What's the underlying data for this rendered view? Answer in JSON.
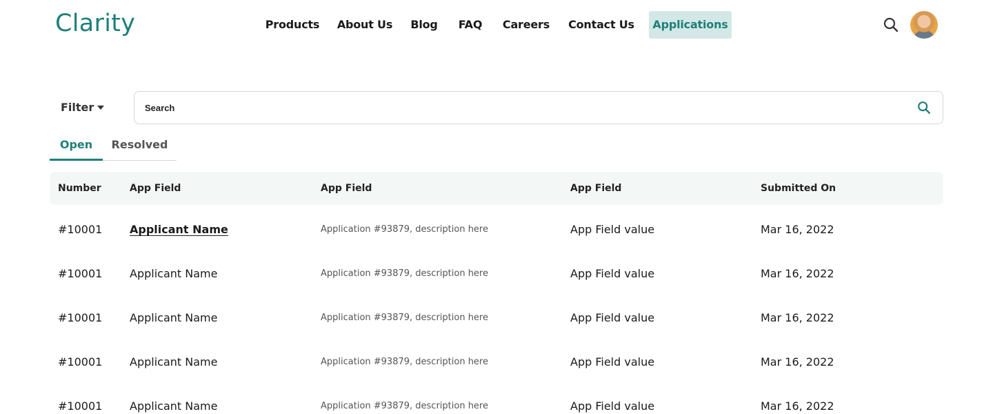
{
  "app": {
    "logo": "Clarity"
  },
  "nav": {
    "items": [
      {
        "label": "Products"
      },
      {
        "label": "About Us"
      },
      {
        "label": "Blog"
      },
      {
        "label": "FAQ"
      },
      {
        "label": "Careers"
      },
      {
        "label": "Contact Us"
      },
      {
        "label": "Applications"
      }
    ],
    "active": "Applications"
  },
  "filter": {
    "label": "Filter"
  },
  "search": {
    "placeholder": "Search"
  },
  "tabs": [
    {
      "label": "Open",
      "selected": true
    },
    {
      "label": "Resolved",
      "selected": false
    }
  ],
  "table": {
    "headers": [
      "Number",
      "App Field",
      "App Field",
      "App Field",
      "Submitted On"
    ],
    "rows": [
      {
        "number": "#10001",
        "name": "Applicant Name",
        "desc": "Application #93879, description here",
        "value": "App Field value",
        "date": "Mar 16, 2022"
      },
      {
        "number": "#10001",
        "name": "Applicant Name",
        "desc": "Application #93879, description here",
        "value": "App Field value",
        "date": "Mar 16, 2022"
      },
      {
        "number": "#10001",
        "name": "Applicant Name",
        "desc": "Application #93879, description here",
        "value": "App Field value",
        "date": "Mar 16, 2022"
      },
      {
        "number": "#10001",
        "name": "Applicant Name",
        "desc": "Application #93879, description here",
        "value": "App Field value",
        "date": "Mar 16, 2022"
      },
      {
        "number": "#10001",
        "name": "Applicant Name",
        "desc": "Application #93879, description here",
        "value": "App Field value",
        "date": "Mar 16, 2022"
      }
    ]
  },
  "colors": {
    "accent": "#1f7f7a",
    "active_nav_bg": "#d3e8e6",
    "table_header_bg": "#f3f8f7"
  },
  "icons": {
    "top_search": "search-icon",
    "search_button": "search-icon",
    "filter_caret": "caret-down-icon",
    "avatar": "user-avatar"
  }
}
